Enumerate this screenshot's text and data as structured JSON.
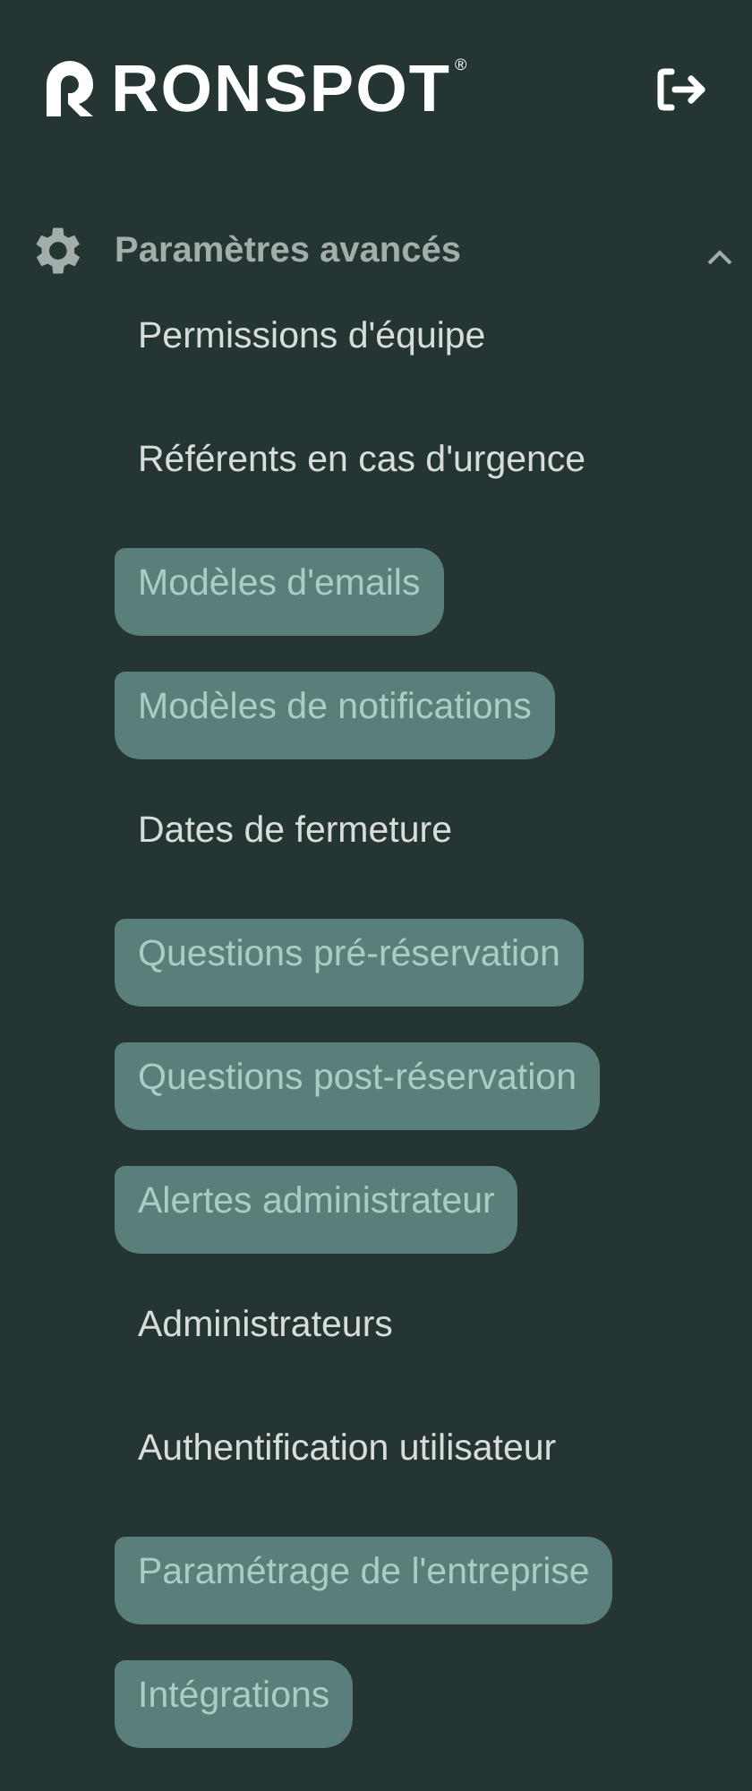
{
  "logo": {
    "text": "RONSPOT",
    "registered_mark": "®"
  },
  "section": {
    "title": "Paramètres avancés",
    "expanded": true,
    "items": [
      {
        "label": "Permissions d'équipe",
        "highlighted": false
      },
      {
        "label": "Référents en cas d'urgence",
        "highlighted": false
      },
      {
        "label": "Modèles d'emails",
        "highlighted": true
      },
      {
        "label": "Modèles de notifications",
        "highlighted": true
      },
      {
        "label": "Dates de fermeture",
        "highlighted": false
      },
      {
        "label": "Questions pré-réservation",
        "highlighted": true
      },
      {
        "label": "Questions post-réservation",
        "highlighted": true
      },
      {
        "label": "Alertes administrateur",
        "highlighted": true
      },
      {
        "label": "Administrateurs",
        "highlighted": false
      },
      {
        "label": "Authentification utilisateur",
        "highlighted": false
      },
      {
        "label": "Paramétrage de l'entreprise",
        "highlighted": true
      },
      {
        "label": "Intégrations",
        "highlighted": true
      }
    ]
  }
}
